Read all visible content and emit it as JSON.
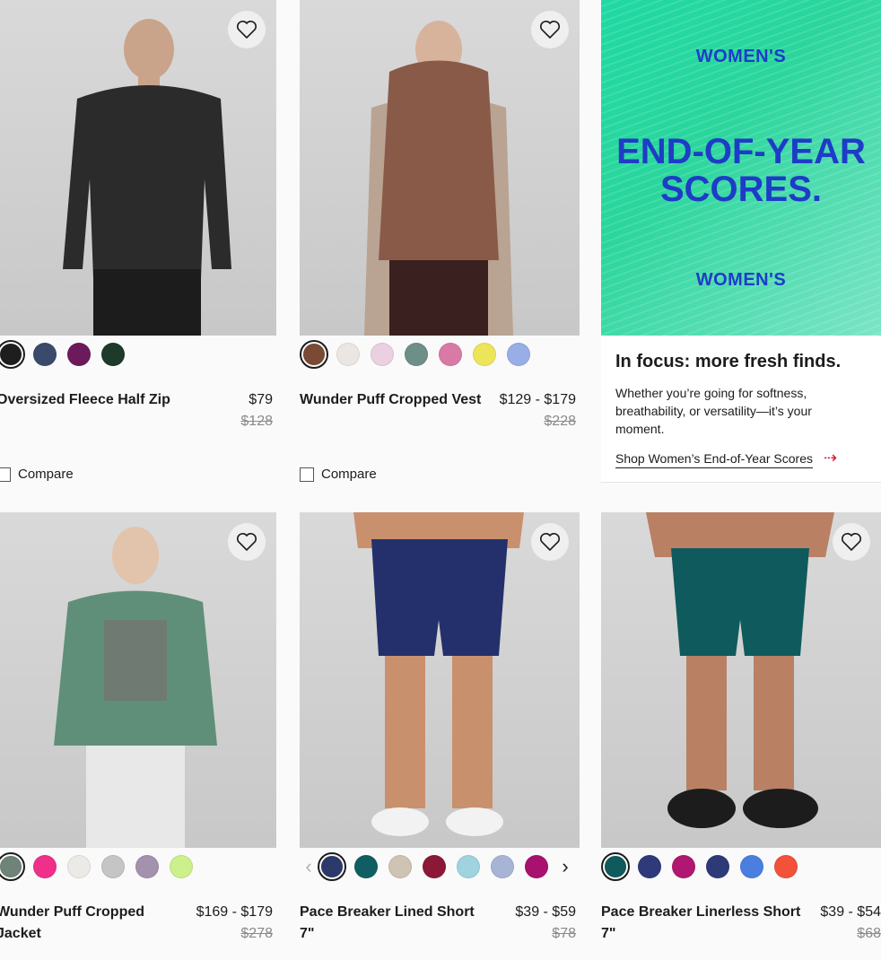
{
  "products": [
    {
      "title": "Oversized Fleece Half Zip",
      "price": "$79",
      "was_price": "$128",
      "compare_label": "Compare",
      "swatch_colors": [
        "#1e1e1e",
        "#3a4a6b",
        "#6d1a5c",
        "#1d3a2a"
      ],
      "selected_swatch": 0
    },
    {
      "title": "Wunder Puff Cropped Vest",
      "price": "$129 - $179",
      "was_price": "$228",
      "compare_label": "Compare",
      "swatch_colors": [
        "#7a4a34",
        "#ece6e2",
        "#ead0e0",
        "#6e8f88",
        "#d97aa6",
        "#ece55a",
        "#98aee6"
      ],
      "selected_swatch": 0
    },
    {
      "title": "Wunder Puff Cropped Jacket",
      "price": "$169 - $179",
      "was_price": "$278",
      "swatch_colors": [
        "#6e8478",
        "#ef2f8a",
        "#eceae7",
        "#c5c5c5",
        "#a491ad",
        "#cbf08c"
      ],
      "selected_swatch": 0
    },
    {
      "title": "Pace Breaker Lined Short 7\"",
      "price": "$39 - $59",
      "was_price": "$78",
      "swatch_colors": [
        "#2b3a6b",
        "#0f5e63",
        "#cfc3b3",
        "#8c1838",
        "#9fd3e0",
        "#a8b4d6",
        "#a8116e"
      ],
      "selected_swatch": 0
    },
    {
      "title": "Pace Breaker Linerless Short 7\"",
      "price": "$39 - $54",
      "was_price": "$68",
      "swatch_colors": [
        "#0f5a5c",
        "#2e3a7a",
        "#b01770",
        "#2e3a78",
        "#4a7fe0",
        "#f2513a"
      ],
      "selected_swatch": 0
    }
  ],
  "promo": {
    "eyebrow_top": "WOMEN'S",
    "headline_1": "END-OF-YEAR",
    "headline_2": "SCORES.",
    "eyebrow_bottom": "WOMEN'S",
    "title": "In focus: more fresh finds.",
    "body": "Whether you’re going for softness, breathability, or versatility—it’s your moment.",
    "link": "Shop Women’s End-of-Year Scores",
    "colors": {
      "banner_green": "#2ad69c",
      "headline_blue": "#1e3cc7",
      "link_arrow": "#d22030"
    }
  },
  "icons": {
    "favorite": "heart-outline-icon",
    "swatch_prev": "chevron-left-icon",
    "swatch_next": "chevron-right-icon",
    "promo_link_arrow": "arrow-right-icon"
  },
  "glyphs": {
    "prev": "‹",
    "next": "›",
    "arrow": "⇢"
  }
}
